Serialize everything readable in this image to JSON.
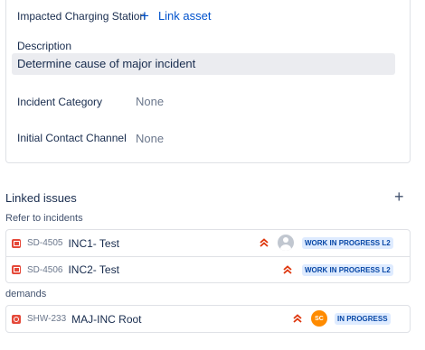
{
  "details": {
    "impacted_station_label": "Impacted Charging Station",
    "link_asset_label": "Link asset",
    "description_label": "Description",
    "description_value": "Determine cause of major incident",
    "incident_category_label": "Incident Category",
    "incident_category_value": "None",
    "contact_channel_label": "Initial Contact Channel",
    "contact_channel_value": "None"
  },
  "linked_issues": {
    "title": "Linked issues",
    "groups": [
      {
        "label": "Refer to incidents",
        "issues": [
          {
            "key": "SD-4505",
            "summary": "INC1- Test",
            "priority": "highest",
            "assignee": "",
            "status": "WORK IN PROGRESS L2"
          },
          {
            "key": "SD-4506",
            "summary": "INC2- Test",
            "priority": "highest",
            "assignee": "",
            "status": "WORK IN PROGRESS L2"
          }
        ]
      },
      {
        "label": "demands",
        "issues": [
          {
            "key": "SHW-233",
            "summary": "MAJ-INC Root",
            "priority": "highest",
            "assignee": "SC",
            "status": "IN PROGRESS"
          }
        ]
      }
    ]
  },
  "colors": {
    "link_blue": "#0052cc",
    "priority_red": "#de350b",
    "issue_type_red": "#e5493a",
    "status_bg": "#deebff",
    "status_text": "#0747a6",
    "avatar_orange": "#ff8b00"
  }
}
